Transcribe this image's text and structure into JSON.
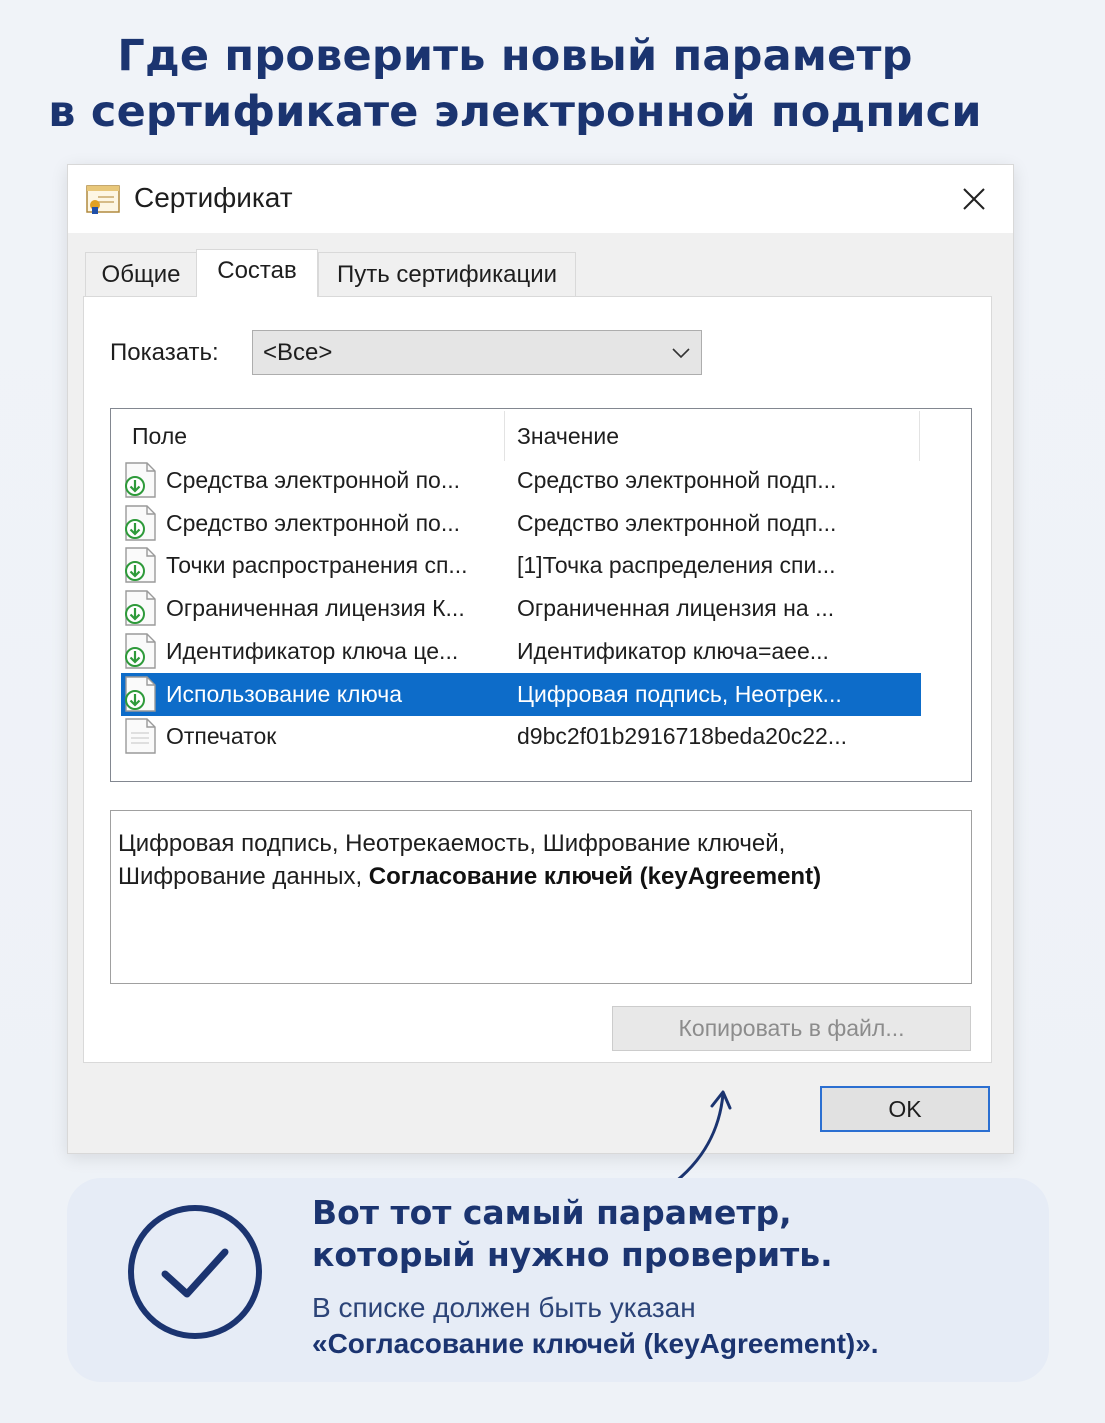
{
  "headline": {
    "line1": "Где проверить новый параметр",
    "line2": "в сертификате электронной подписи"
  },
  "dialog": {
    "title": "Сертификат",
    "tabs": [
      {
        "label": "Общие",
        "active": false
      },
      {
        "label": "Состав",
        "active": true
      },
      {
        "label": "Путь сертификации",
        "active": false
      }
    ],
    "show_label": "Показать:",
    "show_value": "<Все>",
    "columns": {
      "field": "Поле",
      "value": "Значение"
    },
    "rows": [
      {
        "field": "Средства электронной по...",
        "value": "Средство электронной подп...",
        "icon": "extension-icon",
        "selected": false
      },
      {
        "field": "Средство электронной по...",
        "value": "Средство электронной подп...",
        "icon": "extension-icon",
        "selected": false
      },
      {
        "field": "Точки распространения сп...",
        "value": "[1]Точка распределения спи...",
        "icon": "extension-icon",
        "selected": false
      },
      {
        "field": "Ограниченная лицензия К...",
        "value": "Ограниченная лицензия на ...",
        "icon": "extension-icon",
        "selected": false
      },
      {
        "field": "Идентификатор ключа це...",
        "value": "Идентификатор ключа=aee...",
        "icon": "extension-icon",
        "selected": false
      },
      {
        "field": "Использование ключа",
        "value": "Цифровая подпись, Неотрек...",
        "icon": "extension-icon",
        "selected": true
      },
      {
        "field": "Отпечаток",
        "value": "d9bc2f01b2916718beda20c22...",
        "icon": "document-icon",
        "selected": false
      }
    ],
    "details": {
      "text_line1": "Цифровая подпись, Неотрекаемость, Шифрование ключей,",
      "text_line2_plain": "Шифрование данных, ",
      "text_line2_bold": "Согласование ключей (keyAgreement)"
    },
    "copy_button": "Копировать в файл...",
    "ok_button": "OK"
  },
  "callout": {
    "title_line1": "Вот тот самый параметр,",
    "title_line2": "который нужно проверить.",
    "sub": "В списке должен быть указан",
    "bold": "«Согласование ключей (keyAgreement)»."
  },
  "colors": {
    "headline": "#1b3470",
    "selection": "#0d6cc9",
    "ok_border": "#2b6fd1",
    "callout_bg": "#e6ecf6"
  }
}
